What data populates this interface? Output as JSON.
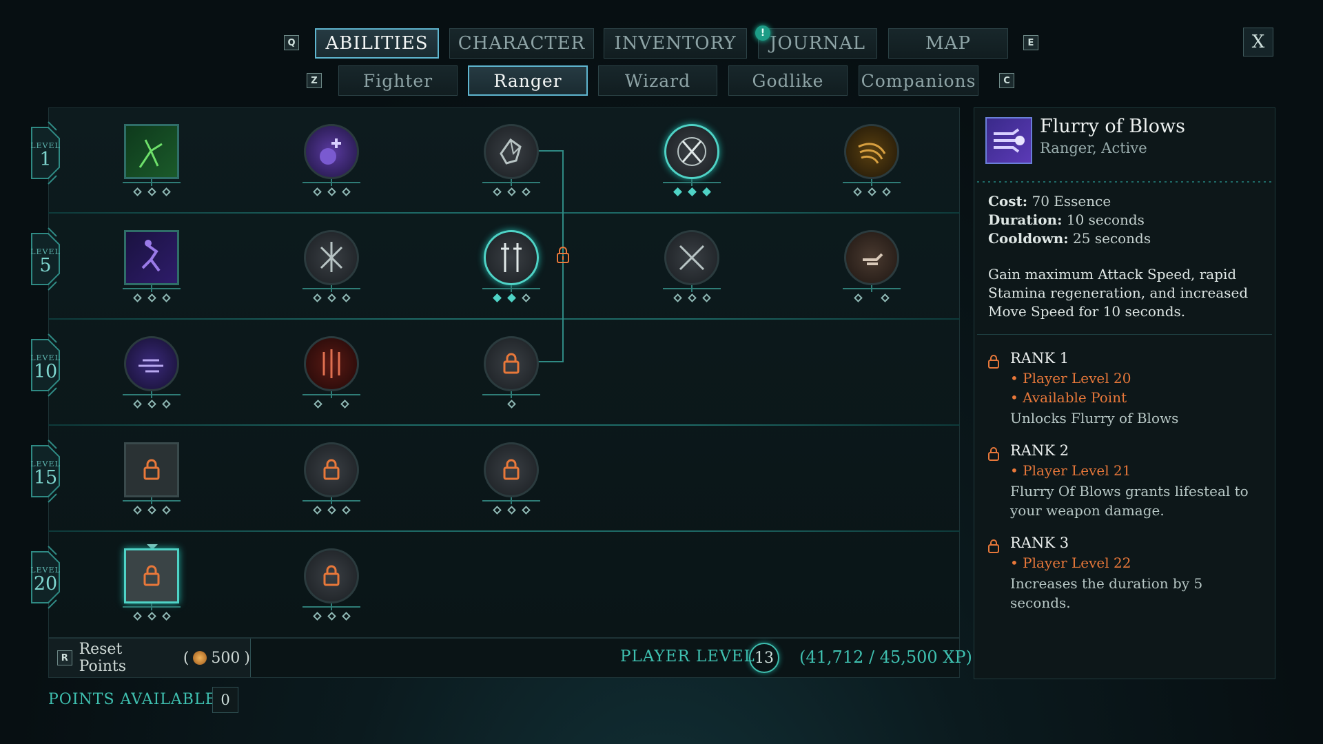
{
  "top_nav": {
    "left_key": "Q",
    "right_key": "E",
    "tabs": [
      {
        "label": "ABILITIES",
        "active": true
      },
      {
        "label": "CHARACTER",
        "active": false
      },
      {
        "label": "INVENTORY",
        "active": false
      },
      {
        "label": "JOURNAL",
        "active": false
      },
      {
        "label": "MAP",
        "active": false
      }
    ],
    "journal_alert": "!",
    "close_label": "X"
  },
  "sub_nav": {
    "left_key": "Z",
    "right_key": "C",
    "tabs": [
      {
        "label": "Fighter",
        "active": false
      },
      {
        "label": "Ranger",
        "active": true
      },
      {
        "label": "Wizard",
        "active": false
      },
      {
        "label": "Godlike",
        "active": false
      },
      {
        "label": "Companions",
        "active": false
      }
    ]
  },
  "tree": {
    "level_word": "LEVEL",
    "levels": [
      "1",
      "5",
      "10",
      "15",
      "20"
    ]
  },
  "bottom": {
    "reset_key": "R",
    "reset_label": "Reset Points",
    "reset_cost": "500",
    "player_level_label": "PLAYER LEVEL",
    "player_level": "13",
    "xp": "(41,712 / 45,500 XP)",
    "points_available_label": "POINTS AVAILABLE",
    "points_available": "0"
  },
  "detail": {
    "title": "Flurry of Blows",
    "subtitle": "Ranger, Active",
    "stats": [
      {
        "label": "Cost:",
        "value": "70 Essence"
      },
      {
        "label": "Duration:",
        "value": "10 seconds"
      },
      {
        "label": "Cooldown:",
        "value": "25 seconds"
      }
    ],
    "description": "Gain maximum Attack Speed, rapid Stamina regeneration, and increased Move Speed for 10 seconds.",
    "ranks": [
      {
        "title": "RANK 1",
        "requirements": [
          "• Player Level 20",
          "• Available Point"
        ],
        "text": "Unlocks Flurry of Blows"
      },
      {
        "title": "RANK 2",
        "requirements": [
          "• Player Level 21"
        ],
        "text": "Flurry Of Blows grants lifesteal to your weapon damage."
      },
      {
        "title": "RANK 3",
        "requirements": [
          "• Player Level 22"
        ],
        "text": "Increases the duration by 5 seconds."
      }
    ]
  },
  "colors": {
    "accent": "#4fd3c6",
    "requirement": "#e8783a",
    "active_tab_border": "#5fb6d0"
  }
}
